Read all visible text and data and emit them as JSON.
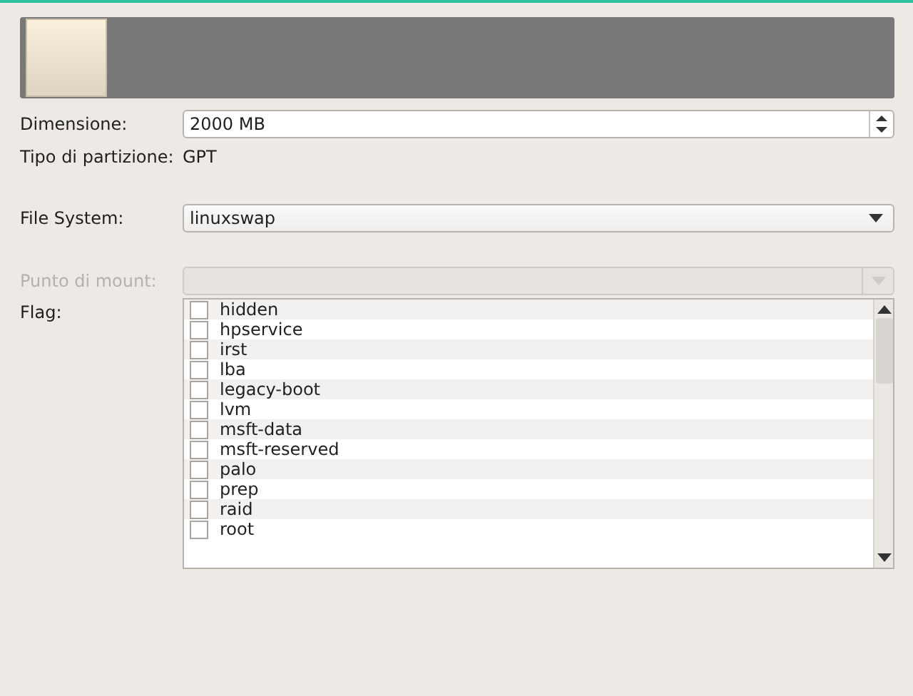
{
  "fields": [
    {
      "kind": "spin",
      "label": "Dimensione:",
      "value": "2000 MB",
      "disabled": false
    },
    {
      "kind": "text",
      "label": "Tipo di partizione:",
      "value": "GPT",
      "disabled": false
    },
    {
      "kind": "combo",
      "label": "File System:",
      "value": "linuxswap",
      "disabled": false
    },
    {
      "kind": "combo",
      "label": "Punto di mount:",
      "disabled": true
    }
  ],
  "flags": {
    "label": "Flag:",
    "items": [
      {
        "name": "hidden",
        "checked": false
      },
      {
        "name": "hpservice",
        "checked": false
      },
      {
        "name": "irst",
        "checked": false
      },
      {
        "name": "lba",
        "checked": false
      },
      {
        "name": "legacy-boot",
        "checked": false
      },
      {
        "name": "lvm",
        "checked": false
      },
      {
        "name": "msft-data",
        "checked": false
      },
      {
        "name": "msft-reserved",
        "checked": false
      },
      {
        "name": "palo",
        "checked": false
      },
      {
        "name": "prep",
        "checked": false
      },
      {
        "name": "raid",
        "checked": false
      },
      {
        "name": "root",
        "checked": false
      }
    ]
  }
}
